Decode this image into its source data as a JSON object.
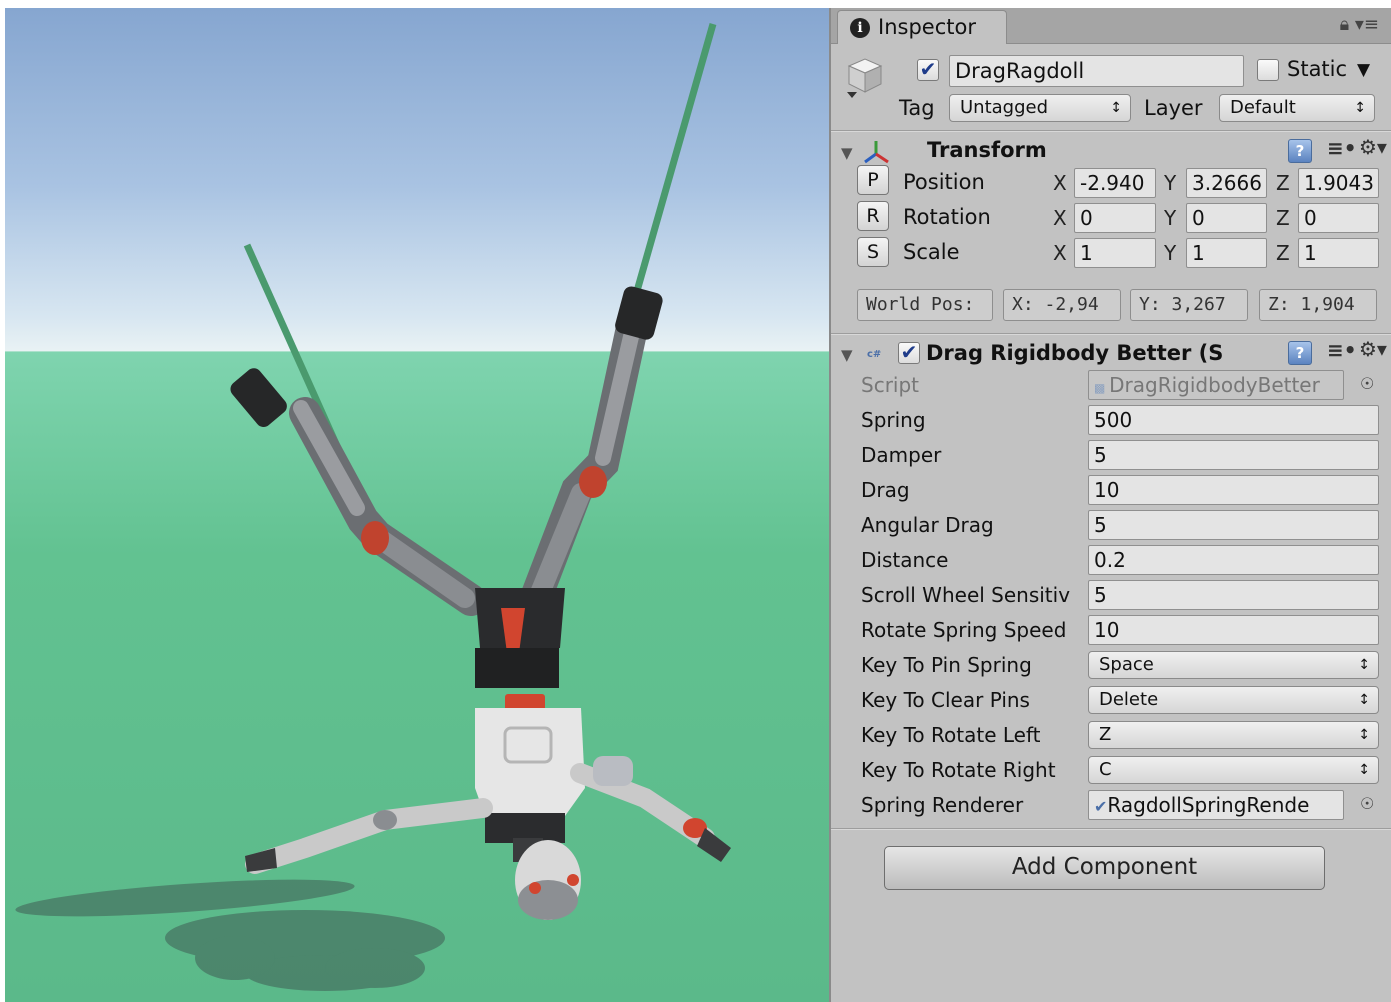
{
  "inspector": {
    "tab_title": "Inspector",
    "lock_icon": "lock-icon",
    "menu_icon": "tab-menu-icon",
    "gameobject": {
      "active": true,
      "name": "DragRagdoll",
      "static_label": "Static",
      "static_checked": false,
      "tag_label": "Tag",
      "tag_value": "Untagged",
      "layer_label": "Layer",
      "layer_value": "Default"
    },
    "transform": {
      "title": "Transform",
      "rows": [
        {
          "button": "P",
          "label": "Position",
          "x": "-2.940",
          "y": "3.2666",
          "z": "1.9043"
        },
        {
          "button": "R",
          "label": "Rotation",
          "x": "0",
          "y": "0",
          "z": "0"
        },
        {
          "button": "S",
          "label": "Scale",
          "x": "1",
          "y": "1",
          "z": "1"
        }
      ],
      "axis_x": "X",
      "axis_y": "Y",
      "axis_z": "Z",
      "world_pos_label": "World Pos:",
      "world_x": "X: -2,94",
      "world_y": "Y: 3,267",
      "world_z": "Z: 1,904"
    },
    "component": {
      "title": "Drag Rigidbody Better (S",
      "enabled": true,
      "script_label": "Script",
      "script_value": "DragRigidbodyBetter",
      "properties": [
        {
          "label": "Spring",
          "value": "500"
        },
        {
          "label": "Damper",
          "value": "5"
        },
        {
          "label": "Drag",
          "value": "10"
        },
        {
          "label": "Angular Drag",
          "value": "5"
        },
        {
          "label": "Distance",
          "value": "0.2"
        },
        {
          "label": "Scroll Wheel Sensitiv",
          "value": "5"
        },
        {
          "label": "Rotate Spring Speed",
          "value": "10"
        }
      ],
      "keys": [
        {
          "label": "Key To Pin Spring",
          "value": "Space"
        },
        {
          "label": "Key To Clear Pins",
          "value": "Delete"
        },
        {
          "label": "Key To Rotate Left",
          "value": "Z"
        },
        {
          "label": "Key To Rotate Right",
          "value": "C"
        }
      ],
      "renderer_label": "Spring Renderer",
      "renderer_value": "RagdollSpringRende"
    },
    "add_component": "Add Component"
  },
  "colors": {
    "sky_top": "#86a6d0",
    "ground": "#62c291",
    "inspector_bg": "#c2c2c2",
    "spring_line": "#4a9a6e",
    "robot_accent": "#d1452f"
  }
}
